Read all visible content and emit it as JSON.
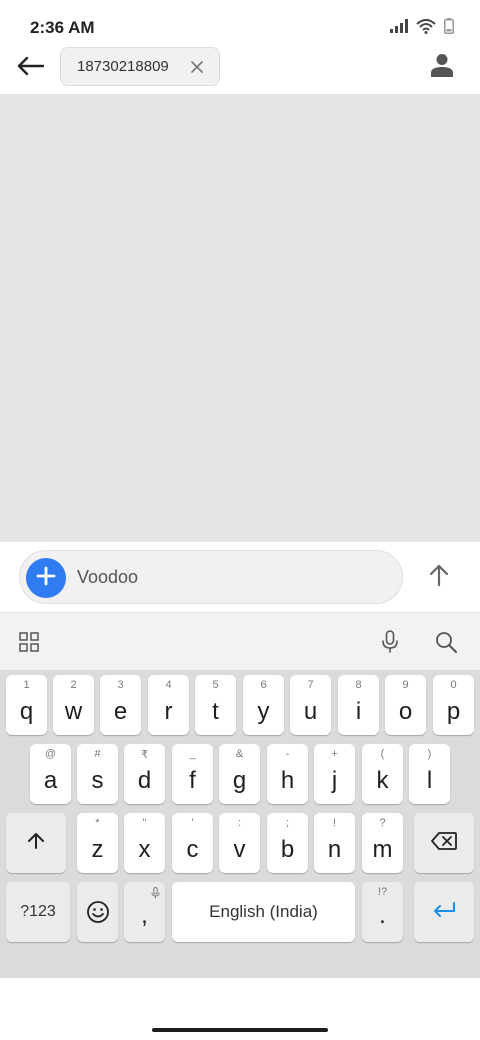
{
  "status_bar": {
    "time": "2:36 AM",
    "icons": [
      "signal-icon",
      "wifi-icon",
      "battery-icon"
    ]
  },
  "app_bar": {
    "back_icon": "arrow-left-icon",
    "recipient": "18730218809",
    "chip_close_icon": "close-icon",
    "contact_icon": "person-icon"
  },
  "compose": {
    "attach_icon": "plus-icon",
    "text": "Voodoo",
    "send_icon": "arrow-up-icon"
  },
  "keyboard": {
    "toolbar_icons": [
      "grid-icon",
      "microphone-icon",
      "search-icon"
    ],
    "row1": [
      {
        "key": "q",
        "hint": "1"
      },
      {
        "key": "w",
        "hint": "2"
      },
      {
        "key": "e",
        "hint": "3"
      },
      {
        "key": "r",
        "hint": "4"
      },
      {
        "key": "t",
        "hint": "5"
      },
      {
        "key": "y",
        "hint": "6"
      },
      {
        "key": "u",
        "hint": "7"
      },
      {
        "key": "i",
        "hint": "8"
      },
      {
        "key": "o",
        "hint": "9"
      },
      {
        "key": "p",
        "hint": "0"
      }
    ],
    "row2": [
      {
        "key": "a",
        "hint": "@"
      },
      {
        "key": "s",
        "hint": "#"
      },
      {
        "key": "d",
        "hint": "₹"
      },
      {
        "key": "f",
        "hint": "_"
      },
      {
        "key": "g",
        "hint": "&"
      },
      {
        "key": "h",
        "hint": "-"
      },
      {
        "key": "j",
        "hint": "+"
      },
      {
        "key": "k",
        "hint": "("
      },
      {
        "key": "l",
        "hint": ")"
      }
    ],
    "row3": [
      {
        "key": "z",
        "hint": "*"
      },
      {
        "key": "x",
        "hint": "\""
      },
      {
        "key": "c",
        "hint": "'"
      },
      {
        "key": "v",
        "hint": ":"
      },
      {
        "key": "b",
        "hint": ";"
      },
      {
        "key": "n",
        "hint": "!"
      },
      {
        "key": "m",
        "hint": "?"
      }
    ],
    "symbols_label": "?123",
    "comma": ",",
    "space_label": "English (India)",
    "period": ".",
    "period_hint": "!?",
    "accent_color": "#1a8ee8"
  }
}
